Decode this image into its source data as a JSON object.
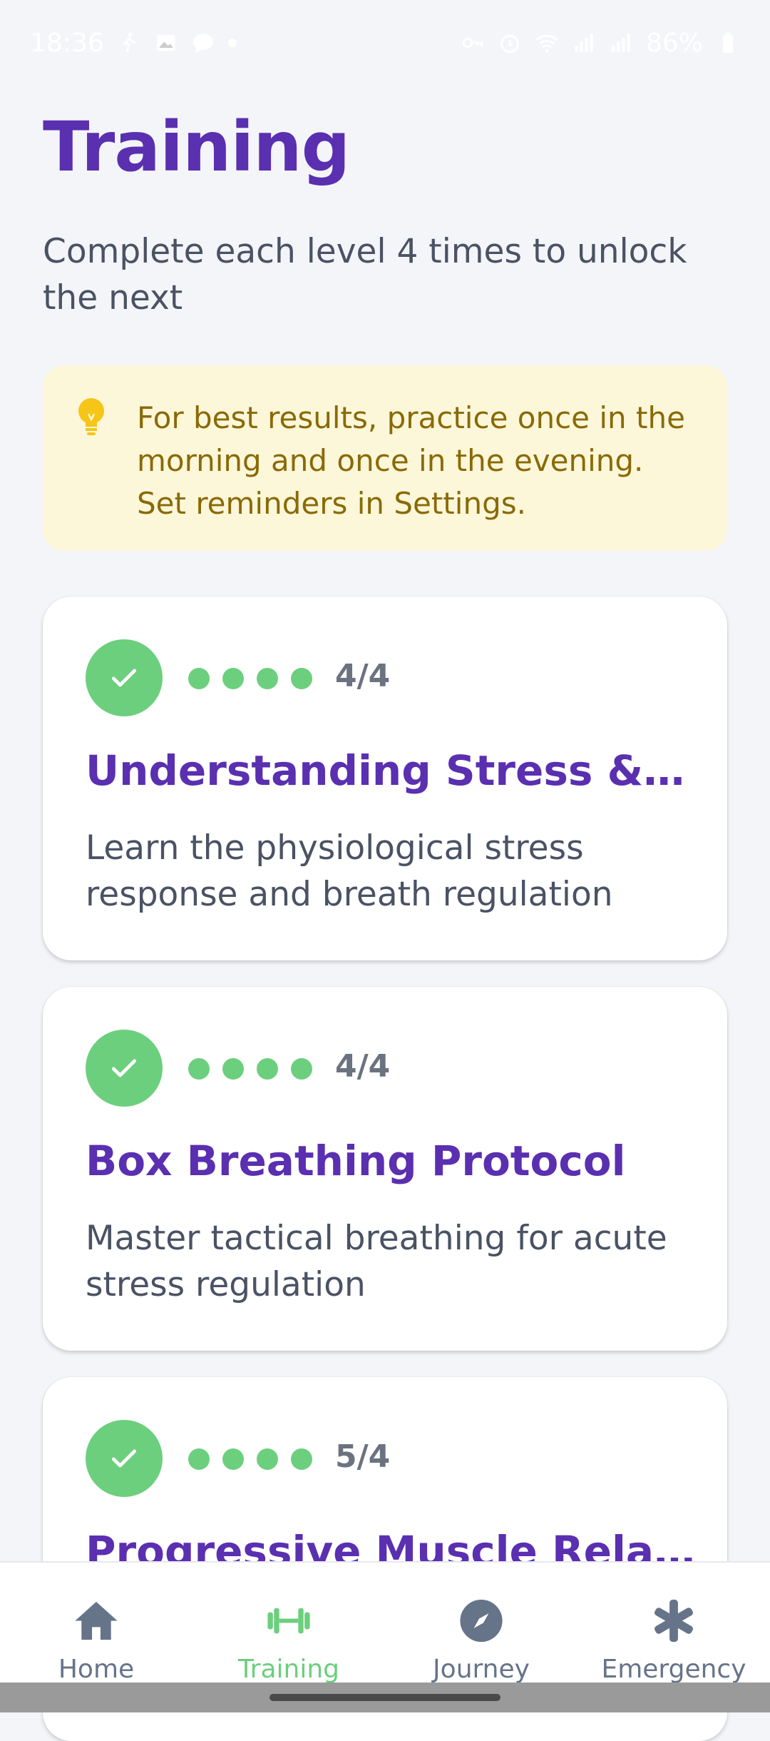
{
  "status_bar": {
    "time": "18:36",
    "battery": "86%",
    "left_icons": [
      "walk-icon",
      "image-icon",
      "chat-icon",
      "dot-icon"
    ],
    "right_icons": [
      "key-icon",
      "alarm-icon",
      "wifi-icon",
      "signal-icon-1",
      "signal-icon-2",
      "battery-icon"
    ]
  },
  "header": {
    "title": "Training",
    "subtitle": "Complete each level 4 times to unlock the next"
  },
  "tip": {
    "icon": "lightbulb-icon",
    "text": "For best results, practice once in the morning and once in the evening. Set reminders in Settings."
  },
  "levels": [
    {
      "title": "Understanding Stress & Breathing",
      "description": "Learn the physiological stress response and breath regulation",
      "progress": "4/4",
      "completed": 4,
      "required": 4
    },
    {
      "title": "Box Breathing Protocol",
      "description": "Master tactical breathing for acute stress regulation",
      "progress": "4/4",
      "completed": 4,
      "required": 4
    },
    {
      "title": "Progressive Muscle Relaxation",
      "description": "",
      "progress": "5/4",
      "completed": 5,
      "required": 4
    }
  ],
  "nav": [
    {
      "label": "Home",
      "icon": "home-icon",
      "active": false
    },
    {
      "label": "Training",
      "icon": "dumbbell-icon",
      "active": true
    },
    {
      "label": "Journey",
      "icon": "compass-icon",
      "active": false
    },
    {
      "label": "Emergency",
      "icon": "asterisk-icon",
      "active": false
    }
  ],
  "colors": {
    "accent": "#5a2fb0",
    "success": "#6ccf7d",
    "tip_background": "#fdf7da",
    "tip_text": "#8a6a06",
    "nav_inactive": "#66748a"
  }
}
